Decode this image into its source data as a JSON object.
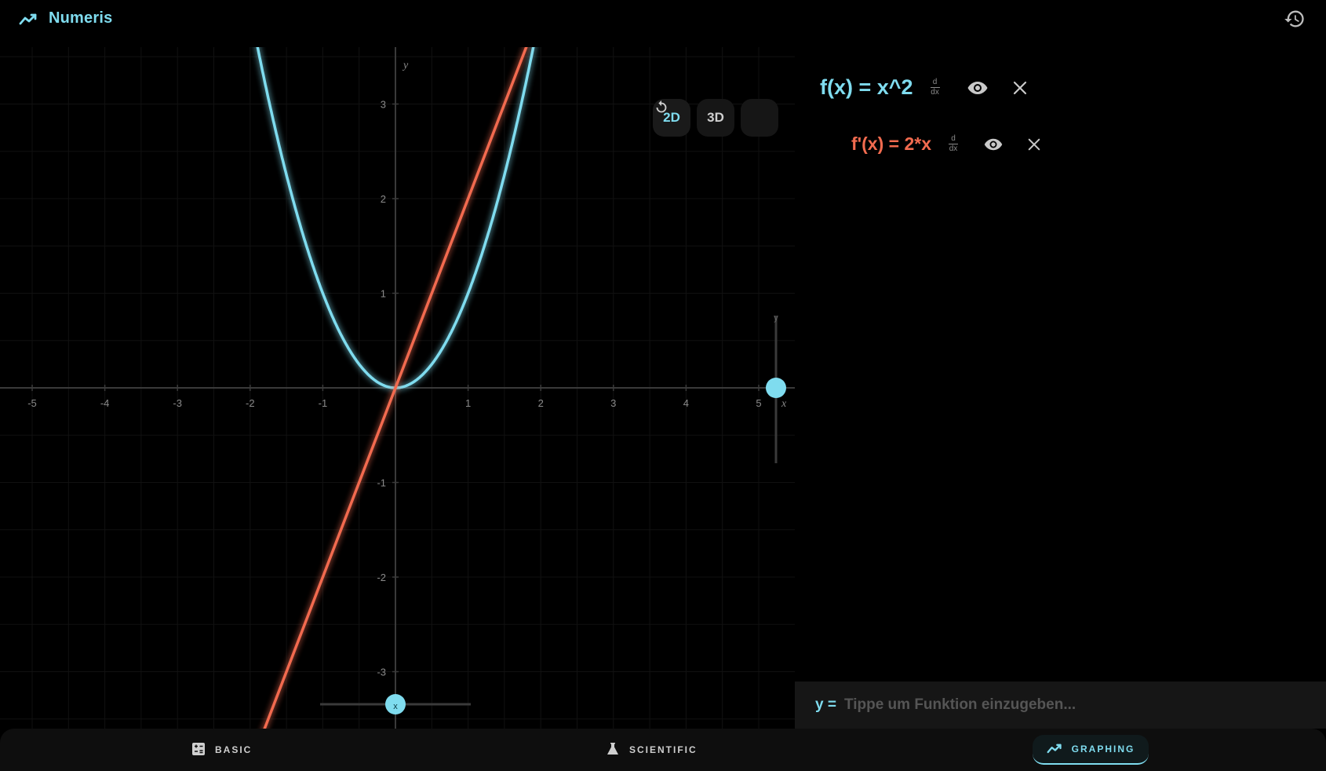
{
  "app": {
    "title": "Numeris",
    "brand_icon": "trending-line-icon",
    "history_icon": "history-icon",
    "accent": "#7fdcef",
    "derivative_color": "#f26b4f"
  },
  "graph": {
    "mode_buttons": [
      {
        "label": "2D",
        "active": true
      },
      {
        "label": "3D",
        "active": false
      }
    ],
    "reset_icon": "reset-icon",
    "axis_x_label": "x",
    "axis_y_label": "y",
    "x_slider_label": "x",
    "y_slider_label": "y"
  },
  "chart_data": {
    "type": "line",
    "xlabel": "x",
    "ylabel": "y",
    "xlim": [
      -5.45,
      5.45
    ],
    "ylim": [
      -3.6,
      3.6
    ],
    "x_ticks": [
      -5,
      -4,
      -3,
      -2,
      -1,
      1,
      2,
      3,
      4,
      5
    ],
    "y_ticks": [
      -3,
      -2,
      -1,
      1,
      2,
      3
    ],
    "grid": true,
    "series": [
      {
        "name": "f(x) = x^2",
        "color": "#7fdcef",
        "x": [
          -2,
          -1.5,
          -1,
          -0.5,
          0,
          0.5,
          1,
          1.5,
          2
        ],
        "y": [
          4,
          2.25,
          1,
          0.25,
          0,
          0.25,
          1,
          2.25,
          4
        ]
      },
      {
        "name": "f'(x) = 2*x",
        "color": "#f26b4f",
        "x": [
          -2,
          -1,
          0,
          1,
          2
        ],
        "y": [
          -4,
          -2,
          0,
          2,
          4
        ]
      }
    ]
  },
  "functions": [
    {
      "expr": "f(x) = x^2",
      "deriv_top": "d",
      "deriv_bottom": "dx"
    },
    {
      "expr": "f'(x) = 2*x",
      "deriv_top": "d",
      "deriv_bottom": "dx"
    }
  ],
  "input": {
    "prefix": "y =",
    "placeholder": "Tippe um Funktion einzugeben...",
    "value": ""
  },
  "nav": {
    "basic": {
      "label": "BASIC",
      "icon": "calculator-icon"
    },
    "scientific": {
      "label": "SCIENTIFIC",
      "icon": "flask-icon"
    },
    "graphing": {
      "label": "GRAPHING",
      "icon": "trending-line-icon",
      "active": true
    }
  }
}
